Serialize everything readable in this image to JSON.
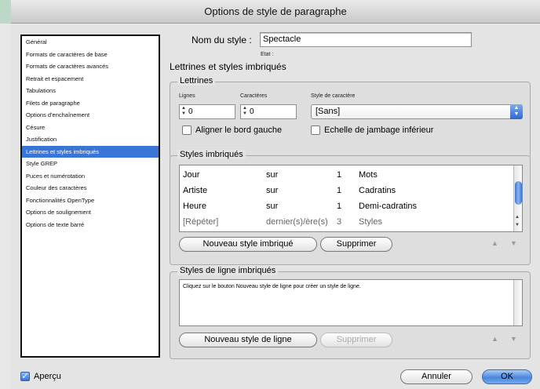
{
  "window": {
    "title": "Options de style de paragraphe"
  },
  "sidebar": {
    "items": [
      "Général",
      "Formats de caractères de base",
      "Formats de caractères avancés",
      "Retrait et espacement",
      "Tabulations",
      "Filets de paragraphe",
      "Options d'enchaînement",
      "Césure",
      "Justification",
      "Lettrines et styles imbriqués",
      "Style GREP",
      "Puces et numérotation",
      "Couleur des caractères",
      "Fonctionnalités OpenType",
      "Options de soulignement",
      "Options de texte barré"
    ],
    "selected_index": 9
  },
  "style_name": {
    "label": "Nom du style :",
    "value": "Spectacle"
  },
  "state_label": "Etat :",
  "section_title": "Lettrines et styles imbriqués",
  "drop_caps": {
    "title": "Lettrines",
    "lines_label": "Lignes",
    "lines_value": "0",
    "chars_label": "Caractères",
    "chars_value": "0",
    "char_style_label": "Style de caractère",
    "char_style_value": "[Sans]",
    "align_left_label": "Aligner le bord gauche",
    "descender_label": "Echelle de jambage inférieur"
  },
  "nested_styles": {
    "title": "Styles imbriqués",
    "rows": [
      {
        "style": "Jour",
        "over": "sur",
        "count": "1",
        "unit": "Mots"
      },
      {
        "style": "Artiste",
        "over": "sur",
        "count": "1",
        "unit": "Cadratins"
      },
      {
        "style": "Heure",
        "over": "sur",
        "count": "1",
        "unit": "Demi-cadratins"
      },
      {
        "style": "[Répéter]",
        "over": "dernier(s)/ère(s)",
        "count": "3",
        "unit": "Styles"
      }
    ],
    "new_button": "Nouveau style imbriqué",
    "delete_button": "Supprimer"
  },
  "line_styles": {
    "title": "Styles de ligne imbriqués",
    "hint": "Cliquez sur le bouton Nouveau style de ligne pour créer un style de ligne.",
    "new_button": "Nouveau style de ligne",
    "delete_button": "Supprimer"
  },
  "footer": {
    "preview_label": "Aperçu",
    "preview_checked": true,
    "cancel_button": "Annuler",
    "ok_button": "OK"
  },
  "icons": {
    "move_up": "triangle-up-icon",
    "move_down": "triangle-down-icon",
    "checkmark": "checkmark-icon"
  },
  "colors": {
    "selection": "#3875d7",
    "primary_button": "#4a86de"
  }
}
